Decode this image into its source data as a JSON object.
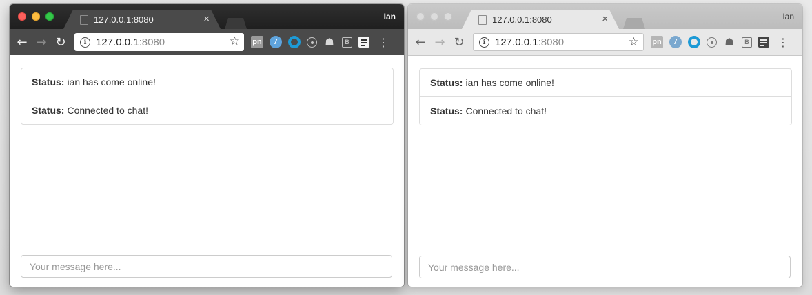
{
  "windows": [
    {
      "state": "active",
      "tab_title": "127.0.0.1:8080",
      "profile_name": "Ian",
      "url_host": "127.0.0.1",
      "url_port": ":8080",
      "statuses": [
        {
          "label": "Status:",
          "text": "ian has come online!"
        },
        {
          "label": "Status:",
          "text": "Connected to chat!"
        }
      ],
      "message_placeholder": "Your message here..."
    },
    {
      "state": "inactive",
      "tab_title": "127.0.0.1:8080",
      "profile_name": "Ian",
      "url_host": "127.0.0.1",
      "url_port": ":8080",
      "statuses": [
        {
          "label": "Status:",
          "text": "ian has come online!"
        },
        {
          "label": "Status:",
          "text": "Connected to chat!"
        }
      ],
      "message_placeholder": "Your message here..."
    }
  ],
  "icons": {
    "back": "←",
    "forward": "→",
    "reload": "↻",
    "info": "i",
    "star": "☆",
    "tab_close": "×",
    "menu": "⋮",
    "ext_pn": "pn",
    "ext_vue": "/",
    "ext_robot": "☗",
    "ext_b": "B"
  },
  "colors": {
    "active_frame": "#4a4a4a",
    "inactive_frame": "#e8e8e8",
    "close_light": "#fc605c",
    "minimize_light": "#fdbc40",
    "maximize_light": "#34c749"
  }
}
